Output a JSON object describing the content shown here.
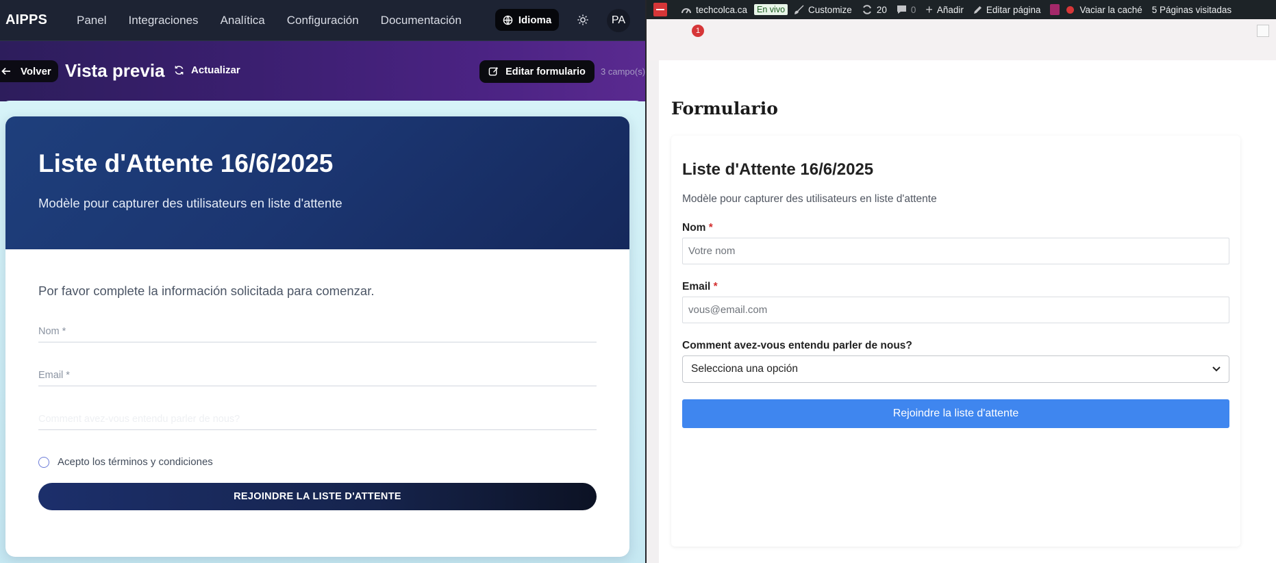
{
  "app": {
    "brand": "AIPPS",
    "nav": [
      "Panel",
      "Integraciones",
      "Analítica",
      "Configuración",
      "Documentación"
    ],
    "language_label": "Idioma",
    "avatar_initials": "PA"
  },
  "toolbar": {
    "back_label": "Volver",
    "title": "Vista previa",
    "refresh_label": "Actualizar",
    "edit_label": "Editar formulario",
    "fields_count": "3 campo(s)"
  },
  "form_preview": {
    "title": "Liste d'Attente 16/6/2025",
    "subtitle": "Modèle pour capturer des utilisateurs en liste d'attente",
    "intro": "Por favor complete la información solicitada para comenzar.",
    "fields": [
      "Nom *",
      "Email *",
      "Comment avez-vous entendu parler de nous?"
    ],
    "terms_label": "Acepto los términos y condiciones",
    "submit_label": "REJOINDRE LA LISTE D'ATTENTE"
  },
  "wp_admin_bar": {
    "site": "techcolca.ca",
    "live_badge": "En vivo",
    "customize": "Customize",
    "updates_count": "20",
    "comments_count": "0",
    "add_new": "Añadir",
    "edit_page": "Editar página",
    "clear_cache": "Vaciar la caché",
    "pages_visited": "5 Páginas visitadas",
    "notifications_count": "1"
  },
  "wp_page": {
    "heading": "Formulario",
    "form_title": "Liste d'Attente 16/6/2025",
    "form_description": "Modèle pour capturer des utilisateurs en liste d'attente",
    "name_label": "Nom",
    "name_placeholder": "Votre nom",
    "email_label": "Email",
    "email_placeholder": "vous@email.com",
    "referral_label": "Comment avez-vous entendu parler de nous?",
    "referral_selected": "Selecciona una opción",
    "required_marker": "*",
    "submit_label": "Rejoindre la liste d'attente"
  },
  "colors": {
    "nav_bg": "#1d2333",
    "hero_blue": "#1e3f7c",
    "wp_button": "#3f86ef",
    "wp_admin_bar": "#1d2327"
  }
}
